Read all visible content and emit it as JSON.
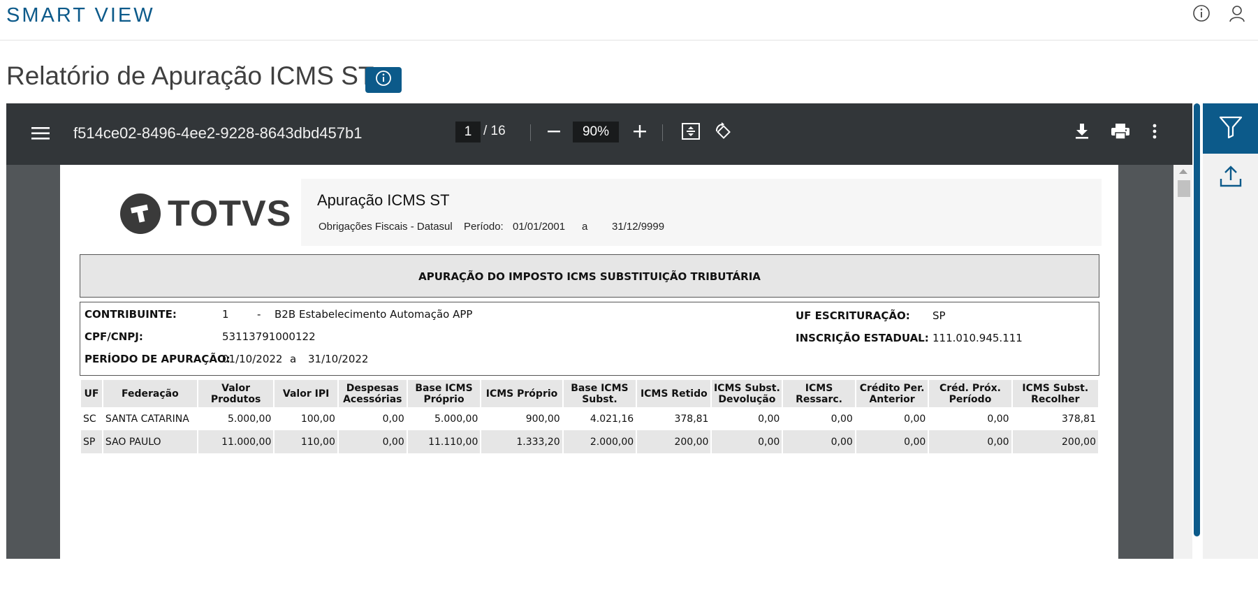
{
  "app": {
    "brand": "SMART VIEW"
  },
  "page": {
    "title": "Relatório de Apuração ICMS ST"
  },
  "viewer": {
    "doc_name": "f514ce02-8496-4ee2-9228-8643dbd457b1",
    "current_page": "1",
    "page_total": "/ 16",
    "zoom": "90%"
  },
  "report": {
    "logo_text": "TOTVS",
    "header_title": "Apuração ICMS ST",
    "header_system": "Obrigações Fiscais - Datasul",
    "periodo_label": "Período:",
    "periodo_from": "01/01/2001",
    "periodo_a": "a",
    "periodo_to": "31/12/9999",
    "section_title": "APURAÇÃO DO IMPOSTO ICMS SUBSTITUIÇÃO TRIBUTÁRIA",
    "contribuinte_label": "CONTRIBUINTE:",
    "contribuinte_code": "1",
    "contribuinte_dash": "-",
    "contribuinte_est": "B2B",
    "contribuinte_name": "Estabelecimento Automação APP",
    "cnpj_label": "CPF/CNPJ:",
    "cnpj_value": "53113791000122",
    "apuracao_label": "PERÍODO DE APURAÇÃO:",
    "apuracao_from": "01/10/2022",
    "apuracao_a": "a",
    "apuracao_to": "31/10/2022",
    "uf_label": "UF ESCRITURAÇÃO:",
    "uf_value": "SP",
    "ie_label": "INSCRIÇÃO ESTADUAL:",
    "ie_value": "111.010.945.111",
    "columns": [
      "UF",
      "Federação",
      "Valor Produtos",
      "Valor IPI",
      "Despesas Acessórias",
      "Base ICMS Próprio",
      "ICMS Próprio",
      "Base ICMS Subst.",
      "ICMS Retido",
      "ICMS Subst. Devolução",
      "ICMS Ressarc.",
      "Crédito Per. Anterior",
      "Créd. Próx. Período",
      "ICMS Subst. Recolher"
    ],
    "rows": [
      [
        "SC",
        "SANTA CATARINA",
        "5.000,00",
        "100,00",
        "0,00",
        "5.000,00",
        "900,00",
        "4.021,16",
        "378,81",
        "0,00",
        "0,00",
        "0,00",
        "0,00",
        "378,81"
      ],
      [
        "SP",
        "SAO PAULO",
        "11.000,00",
        "110,00",
        "0,00",
        "11.110,00",
        "1.333,20",
        "2.000,00",
        "200,00",
        "0,00",
        "0,00",
        "0,00",
        "0,00",
        "200,00"
      ]
    ]
  },
  "colors": {
    "brand": "#0c5a8a",
    "toolbar": "#323639",
    "viewer_bg": "#525659"
  }
}
